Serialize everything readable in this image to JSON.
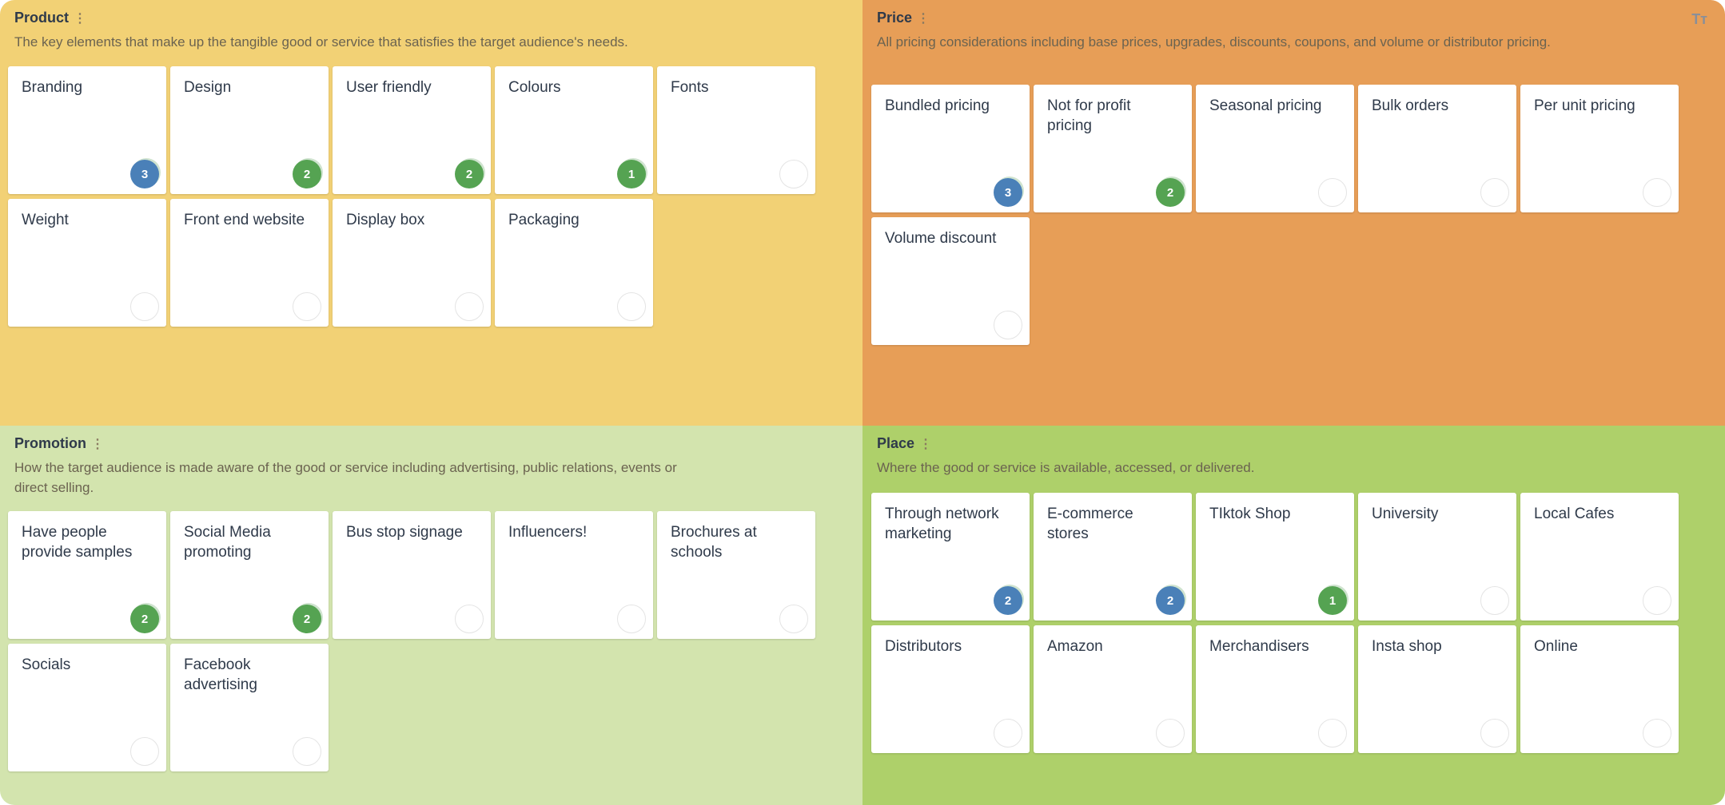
{
  "colors": {
    "product": "#F2D175",
    "price": "#E79E57",
    "promotion": "#D3E4AE",
    "place": "#AED06A",
    "badge_blue": "#4A80B8",
    "badge_green": "#55A352"
  },
  "quadrants": [
    {
      "title": "Product",
      "description": "The key elements that make up the tangible good or service that satisfies the target audience's needs.",
      "cards": [
        {
          "label": "Branding",
          "votes": "3",
          "color": "blue"
        },
        {
          "label": "Design",
          "votes": "2",
          "color": "green"
        },
        {
          "label": "User friendly",
          "votes": "2",
          "color": "green"
        },
        {
          "label": "Colours",
          "votes": "1",
          "color": "green"
        },
        {
          "label": "Fonts"
        },
        {
          "label": "Weight"
        },
        {
          "label": "Front end website"
        },
        {
          "label": "Display box"
        },
        {
          "label": "Packaging"
        }
      ]
    },
    {
      "title": "Price",
      "description": "All pricing considerations including base prices, upgrades, discounts, coupons, and volume or distributor pricing.",
      "cards": [
        {
          "label": "Bundled pricing",
          "votes": "3",
          "color": "blue"
        },
        {
          "label": "Not for profit pricing",
          "votes": "2",
          "color": "green"
        },
        {
          "label": "Seasonal pricing"
        },
        {
          "label": "Bulk orders"
        },
        {
          "label": "Per unit pricing"
        },
        {
          "label": "Volume discount"
        }
      ]
    },
    {
      "title": "Promotion",
      "description": "How the target audience is made aware of the good or service including advertising, public relations, events or direct selling.",
      "cards": [
        {
          "label": "Have people provide samples",
          "votes": "2",
          "color": "green"
        },
        {
          "label": "Social Media promoting",
          "votes": "2",
          "color": "green"
        },
        {
          "label": "Bus stop signage"
        },
        {
          "label": "Influencers!"
        },
        {
          "label": "Brochures at schools"
        },
        {
          "label": "Socials"
        },
        {
          "label": "Facebook advertising"
        }
      ]
    },
    {
      "title": "Place",
      "description": "Where the good or service is available, accessed, or delivered.",
      "cards": [
        {
          "label": "Through network marketing",
          "votes": "2",
          "color": "blue"
        },
        {
          "label": "E-commerce stores",
          "votes": "2",
          "color": "blue"
        },
        {
          "label": "TIktok Shop",
          "votes": "1",
          "color": "green"
        },
        {
          "label": "University"
        },
        {
          "label": "Local Cafes"
        },
        {
          "label": "Distributors"
        },
        {
          "label": "Amazon"
        },
        {
          "label": "Merchandisers"
        },
        {
          "label": "Insta shop"
        },
        {
          "label": "Online"
        }
      ]
    }
  ],
  "toolbar": {
    "text_size_icon": "Tт"
  }
}
